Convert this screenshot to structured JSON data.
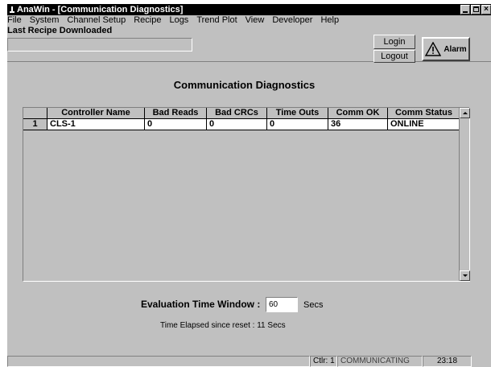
{
  "window": {
    "title": "AnaWin - [Communication Diagnostics]"
  },
  "menu": [
    "File",
    "System",
    "Channel Setup",
    "Recipe",
    "Logs",
    "Trend Plot",
    "View",
    "Developer",
    "Help"
  ],
  "header": {
    "recipe_label": "Last Recipe Downloaded",
    "recipe_value": "",
    "login_label": "Login",
    "logout_label": "Logout",
    "alarm_label": "Alarm"
  },
  "main": {
    "title": "Communication Diagnostics",
    "table": {
      "columns": [
        "",
        "Controller Name",
        "Bad Reads",
        "Bad CRCs",
        "Time Outs",
        "Comm OK",
        "Comm Status"
      ],
      "rows": [
        [
          "1",
          "CLS-1",
          "0",
          "0",
          "0",
          "36",
          "ONLINE"
        ]
      ]
    },
    "eval_label": "Evaluation Time Window :",
    "eval_value": "60",
    "eval_unit": "Secs",
    "elapsed_text": "Time Elapsed since reset : 11 Secs"
  },
  "status": {
    "controller": "Ctlr: 1",
    "state": "COMMUNICATING",
    "time": "23:18"
  },
  "colors": {
    "face": "#c0c0c0",
    "titlebar": "#000000"
  }
}
